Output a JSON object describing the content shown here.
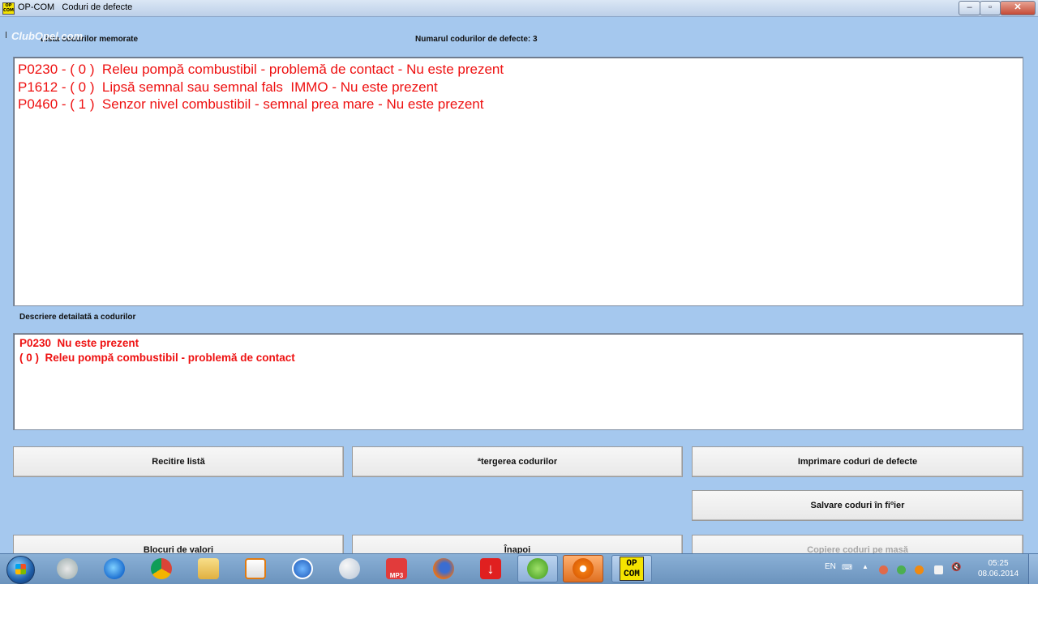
{
  "window": {
    "app_name": "OP-COM",
    "title": "Coduri de defecte",
    "minimize_symbol": "–",
    "maximize_symbol": "▫",
    "close_symbol": "✕",
    "icon_text_top": "OP",
    "icon_text_bottom": "COM"
  },
  "watermark": "ClubOpel.com",
  "header": {
    "list_label": "Lista codurilor memorate",
    "count_label": "Numarul codurilor de defecte: 3"
  },
  "fault_codes": [
    "P0230 - ( 0 )  Releu pompă combustibil - problemă de contact - Nu este prezent",
    "P1612 - ( 0 )  Lipsă semnal sau semnal fals  IMMO - Nu este prezent",
    "P0460 - ( 1 )  Senzor nivel combustibil - semnal prea mare - Nu este prezent"
  ],
  "detail": {
    "label": "Descriere detailată a codurilor",
    "lines": [
      "P0230  Nu este prezent",
      "( 0 )  Releu pompă combustibil - problemă de contact"
    ]
  },
  "buttons": {
    "reread": "Recitire listă",
    "erase": "ªtergerea codurilor",
    "print": "Imprimare coduri de defecte",
    "save": "Salvare coduri în fiºier",
    "blocks": "Blocuri de valori",
    "back": "Înapoi",
    "copy": "Copiere coduri pe masă"
  },
  "taskbar": {
    "opcom_line1": "OP",
    "opcom_line2": "COM",
    "language": "EN",
    "time": "05:25",
    "date": "08.06.2014",
    "mp3_label": "MP3"
  },
  "colors": {
    "accent_red": "#ee1111",
    "client_bg": "#a5c8ee"
  }
}
